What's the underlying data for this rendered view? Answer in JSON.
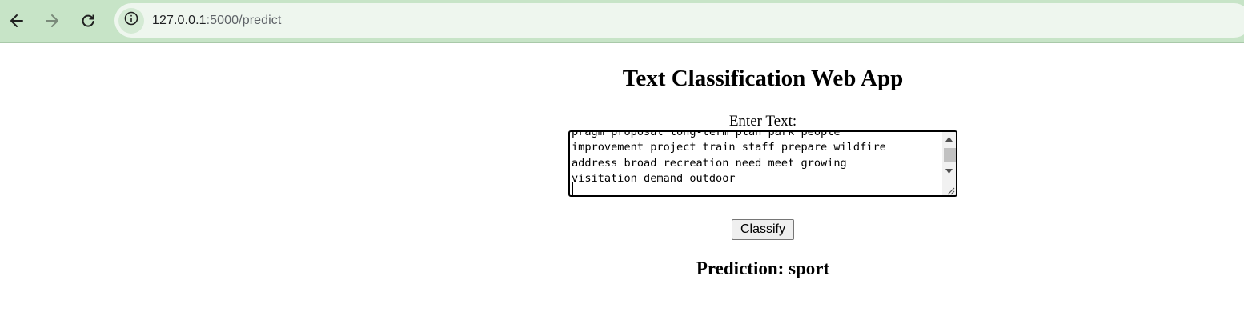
{
  "browser": {
    "url_host": "127.0.0.1",
    "url_rest": ":5000/predict",
    "icons": {
      "back": "arrow-left-icon",
      "forward": "arrow-right-icon",
      "reload": "reload-icon",
      "site_info": "info-icon"
    }
  },
  "app": {
    "title": "Text Classification Web App",
    "input_label": "Enter Text:",
    "input_value": "pragm proposal long-term plan park people\nimprovement project train staff prepare wildfire\naddress broad recreation need meet growing\nvisitation demand outdoor",
    "classify_label": "Classify",
    "prediction_text": "Prediction: sport"
  },
  "colors": {
    "toolbar_bg": "#c7e4c7",
    "address_bg": "#eef6ee"
  }
}
